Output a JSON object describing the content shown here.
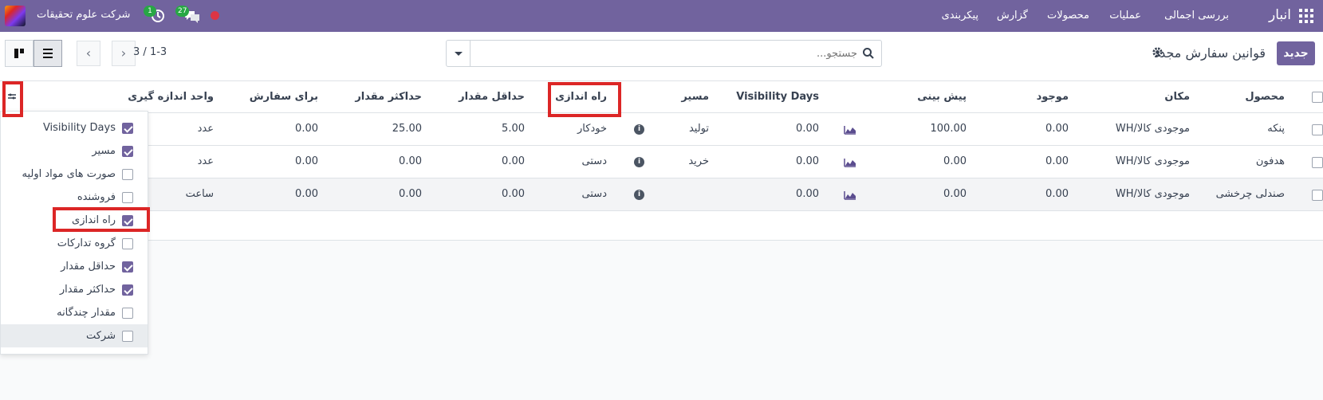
{
  "navbar": {
    "app_name": "انبار",
    "menu": [
      "بررسی اجمالی",
      "عملیات",
      "محصولات",
      "گزارش",
      "پیکربندی"
    ],
    "company": "شرکت علوم تحقیقات",
    "messages_count": "27",
    "activities_count": "1"
  },
  "control_panel": {
    "new_button": "جدید",
    "title": "قوانین سفارش مجدد",
    "search_placeholder": "جستجو...",
    "pager": "1-3 / 3"
  },
  "table": {
    "columns": {
      "product": "محصول",
      "location": "مکان",
      "on_hand": "موجود",
      "forecast": "پیش بینی",
      "visibility_days": "Visibility Days",
      "route": "مسیر",
      "trigger": "راه اندازی",
      "min_qty": "حداقل مقدار",
      "max_qty": "حداکثر مقدار",
      "to_order": "برای سفارش",
      "uom": "واحد اندازه گیری"
    },
    "rows": [
      {
        "product": "پنکه",
        "location": "WH/موجودی کالا",
        "on_hand": "0.00",
        "forecast": "100.00",
        "visibility_days": "0.00",
        "route": "تولید",
        "trigger": "خودکار",
        "min_qty": "5.00",
        "max_qty": "25.00",
        "to_order": "0.00",
        "uom": "عدد"
      },
      {
        "product": "هدفون",
        "location": "WH/موجودی کالا",
        "on_hand": "0.00",
        "forecast": "0.00",
        "visibility_days": "0.00",
        "route": "خرید",
        "trigger": "دستی",
        "min_qty": "0.00",
        "max_qty": "0.00",
        "to_order": "0.00",
        "uom": "عدد"
      },
      {
        "product": "صندلی چرخشی",
        "location": "WH/موجودی کالا",
        "on_hand": "0.00",
        "forecast": "0.00",
        "visibility_days": "0.00",
        "route": "",
        "trigger": "دستی",
        "min_qty": "0.00",
        "max_qty": "0.00",
        "to_order": "0.00",
        "uom": "ساعت"
      }
    ]
  },
  "optional_columns": [
    {
      "label": "Visibility Days",
      "checked": true
    },
    {
      "label": "مسیر",
      "checked": true
    },
    {
      "label": "صورت های مواد اولیه",
      "checked": false
    },
    {
      "label": "فروشنده",
      "checked": false
    },
    {
      "label": "راه اندازی",
      "checked": true
    },
    {
      "label": "گروه تدارکات",
      "checked": false
    },
    {
      "label": "حداقل مقدار",
      "checked": true
    },
    {
      "label": "حداکثر مقدار",
      "checked": true
    },
    {
      "label": "مقدار چندگانه",
      "checked": false
    },
    {
      "label": "شرکت",
      "checked": false
    }
  ],
  "colors": {
    "brand": "#71639e",
    "highlight": "#dc2626"
  }
}
